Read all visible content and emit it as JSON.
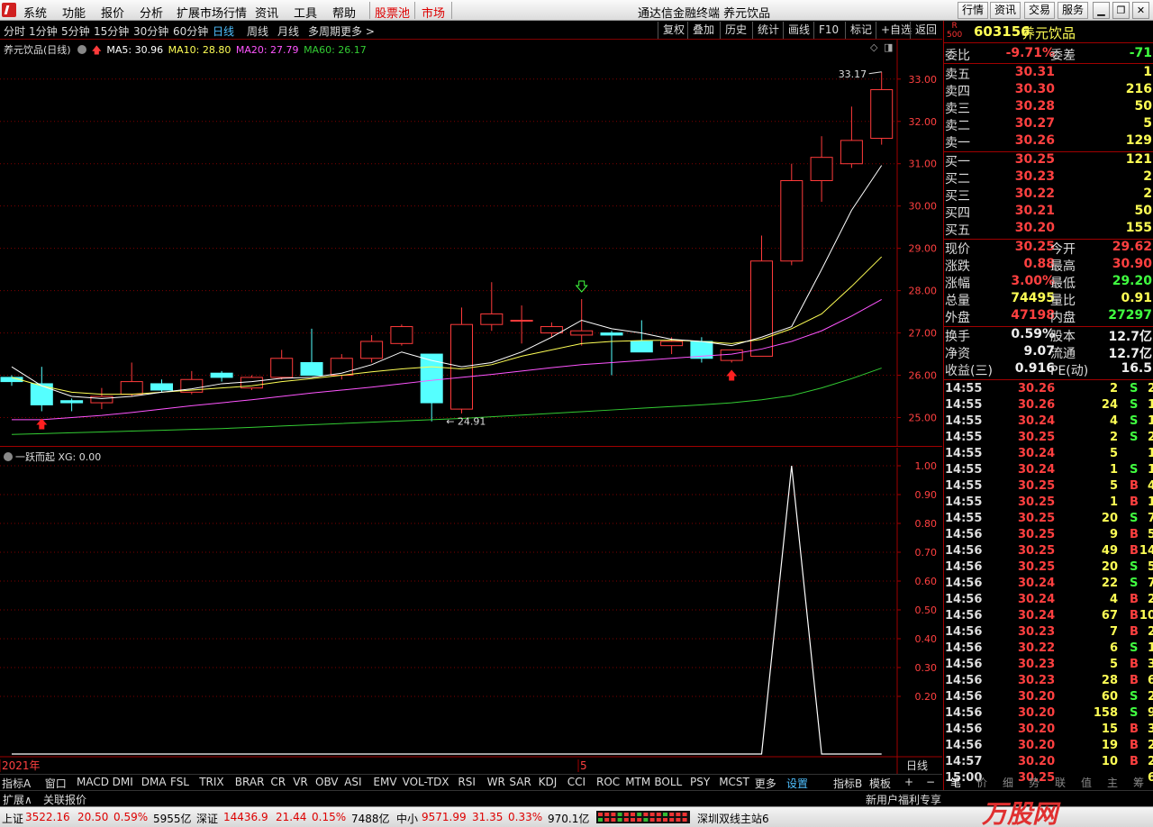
{
  "menubar": {
    "items": [
      "系统",
      "功能",
      "报价",
      "分析",
      "扩展市场行情",
      "资讯",
      "工具",
      "帮助"
    ],
    "stock_pool": "股票池",
    "market": "市场",
    "title": "通达信金融终端  养元饮品",
    "right_buttons": [
      "行情",
      "资讯",
      "交易",
      "服务"
    ]
  },
  "periodbar": {
    "periods": [
      "分时",
      "1分钟",
      "5分钟",
      "15分钟",
      "30分钟",
      "60分钟",
      "日线",
      "周线",
      "月线",
      "多周期",
      "更多 >"
    ],
    "active": "日线",
    "tools": [
      "复权",
      "叠加",
      "历史",
      "统计",
      "画线",
      "F10",
      "标记",
      "+自选",
      "返回"
    ]
  },
  "legend": {
    "stock": "养元饮品(日线)",
    "ma5": "MA5: 30.96",
    "ma10": "MA10: 28.80",
    "ma20": "MA20: 27.79",
    "ma60": "MA60: 26.17",
    "high_label": "33.17",
    "low_label": "24.91"
  },
  "colors": {
    "ma5": "#ffffff",
    "ma10": "#ffff55",
    "ma20": "#ff55ff",
    "ma60": "#33cc33",
    "up": "#ff3b3b",
    "down": "#55ffff",
    "grid": "#800000"
  },
  "chart_data": [
    {
      "type": "candlestick",
      "ylim": [
        24.5,
        33.4
      ],
      "y_ticks": [
        25.0,
        26.0,
        27.0,
        28.0,
        29.0,
        30.0,
        31.0,
        32.0,
        33.0
      ],
      "x_labels": [
        "2021年",
        "5"
      ],
      "ohlc": [
        [
          25.95,
          26.0,
          25.75,
          25.85
        ],
        [
          25.8,
          26.2,
          25.15,
          25.3
        ],
        [
          25.4,
          25.45,
          25.15,
          25.35
        ],
        [
          25.35,
          25.7,
          25.2,
          25.5
        ],
        [
          25.55,
          26.3,
          25.5,
          25.85
        ],
        [
          25.8,
          25.9,
          25.6,
          25.65
        ],
        [
          25.6,
          26.1,
          25.55,
          25.9
        ],
        [
          26.05,
          26.1,
          25.85,
          25.95
        ],
        [
          25.7,
          26.0,
          25.65,
          25.95
        ],
        [
          25.95,
          26.6,
          25.9,
          26.4
        ],
        [
          26.3,
          27.1,
          26.0,
          26.0
        ],
        [
          26.0,
          26.5,
          25.9,
          26.4
        ],
        [
          26.4,
          26.95,
          26.3,
          26.8
        ],
        [
          26.75,
          27.2,
          26.7,
          27.15
        ],
        [
          26.5,
          26.5,
          24.91,
          25.35
        ],
        [
          25.2,
          27.6,
          25.1,
          27.2
        ],
        [
          27.2,
          28.2,
          27.05,
          27.45
        ],
        [
          27.3,
          27.65,
          26.75,
          27.3
        ],
        [
          27.0,
          27.25,
          26.9,
          27.15
        ],
        [
          26.95,
          27.8,
          26.7,
          27.05
        ],
        [
          27.0,
          27.05,
          26.0,
          26.95
        ],
        [
          26.8,
          27.3,
          26.55,
          26.55
        ],
        [
          26.7,
          26.9,
          26.5,
          26.8
        ],
        [
          26.8,
          26.9,
          26.3,
          26.4
        ],
        [
          26.35,
          26.6,
          26.3,
          26.6
        ],
        [
          26.45,
          29.3,
          26.45,
          28.7
        ],
        [
          28.7,
          31.0,
          28.6,
          30.6
        ],
        [
          30.6,
          31.65,
          30.1,
          31.15
        ],
        [
          31.0,
          32.35,
          30.9,
          31.55
        ],
        [
          31.6,
          33.17,
          31.45,
          32.75
        ]
      ],
      "ma5": [
        26.2,
        25.75,
        25.5,
        25.45,
        25.5,
        25.6,
        25.68,
        25.8,
        25.85,
        25.93,
        25.95,
        26.05,
        26.25,
        26.55,
        26.35,
        26.2,
        26.3,
        26.55,
        26.9,
        27.3,
        27.1,
        27.0,
        26.85,
        26.8,
        26.7,
        26.9,
        27.15,
        28.5,
        29.9,
        30.96
      ],
      "ma10": [
        25.95,
        25.75,
        25.6,
        25.55,
        25.55,
        25.6,
        25.65,
        25.7,
        25.75,
        25.85,
        25.92,
        26.0,
        26.08,
        26.15,
        26.2,
        26.15,
        26.25,
        26.45,
        26.6,
        26.75,
        26.8,
        26.82,
        26.83,
        26.8,
        26.75,
        26.85,
        27.1,
        27.45,
        28.1,
        28.8
      ],
      "ma20": [
        24.95,
        24.95,
        25.0,
        25.05,
        25.12,
        25.2,
        25.28,
        25.35,
        25.42,
        25.5,
        25.58,
        25.65,
        25.72,
        25.8,
        25.88,
        25.95,
        26.02,
        26.1,
        26.18,
        26.25,
        26.3,
        26.35,
        26.4,
        26.45,
        26.5,
        26.62,
        26.8,
        27.05,
        27.4,
        27.79
      ],
      "ma60": [
        24.6,
        24.62,
        24.64,
        24.66,
        24.68,
        24.7,
        24.72,
        24.74,
        24.77,
        24.8,
        24.83,
        24.86,
        24.89,
        24.92,
        24.95,
        24.98,
        25.02,
        25.06,
        25.1,
        25.14,
        25.18,
        25.22,
        25.26,
        25.3,
        25.35,
        25.42,
        25.52,
        25.7,
        25.92,
        26.17
      ],
      "signal_arrows_up": [
        1,
        24
      ],
      "signal_arrows_down": [
        19
      ]
    },
    {
      "type": "line",
      "name": "一跃而起",
      "title": "一跃而起  XG: 0.00",
      "ylim": [
        0,
        1.0
      ],
      "y_ticks": [
        0.2,
        0.3,
        0.4,
        0.5,
        0.6,
        0.7,
        0.8,
        0.9,
        1.0
      ],
      "values": [
        0,
        0,
        0,
        0,
        0,
        0,
        0,
        0,
        0,
        0,
        0,
        0,
        0,
        0,
        0,
        0,
        0,
        0,
        0,
        0,
        0,
        0,
        0,
        0,
        0,
        0,
        1,
        0,
        0,
        0
      ]
    }
  ],
  "period_label": "日线",
  "indicator_tabs": [
    "指标A",
    "窗口",
    "MACD",
    "DMI",
    "DMA",
    "FSL",
    "TRIX",
    "BRAR",
    "CR",
    "VR",
    "OBV",
    "ASI",
    "EMV",
    "VOL-TDX",
    "RSI",
    "WR",
    "SAR",
    "KDJ",
    "CCI",
    "ROC",
    "MTM",
    "BOLL",
    "PSY",
    "MCST",
    "更多",
    "设置"
  ],
  "indicator_right_tabs": [
    "指标B",
    "模板",
    "+",
    "−"
  ],
  "ext_bar": [
    "扩展∧",
    "关联报价",
    "新用户福利专享"
  ],
  "quote": {
    "badge_top": "R",
    "badge_bottom": "500",
    "code": "603156",
    "name": "养元饮品",
    "weibi_label": "委比",
    "weibi": "-9.71%",
    "weicha_label": "委差",
    "weicha": "-71",
    "sell": [
      {
        "label": "卖五",
        "price": "30.31",
        "vol": "1"
      },
      {
        "label": "卖四",
        "price": "30.30",
        "vol": "216"
      },
      {
        "label": "卖三",
        "price": "30.28",
        "vol": "50"
      },
      {
        "label": "卖二",
        "price": "30.27",
        "vol": "5"
      },
      {
        "label": "卖一",
        "price": "30.26",
        "vol": "129"
      }
    ],
    "buy": [
      {
        "label": "买一",
        "price": "30.25",
        "vol": "121"
      },
      {
        "label": "买二",
        "price": "30.23",
        "vol": "2"
      },
      {
        "label": "买三",
        "price": "30.22",
        "vol": "2"
      },
      {
        "label": "买四",
        "price": "30.21",
        "vol": "50"
      },
      {
        "label": "买五",
        "price": "30.20",
        "vol": "155"
      }
    ],
    "stats": [
      {
        "l": "现价",
        "v": "30.25",
        "vc": "red",
        "l2": "今开",
        "v2": "29.62",
        "v2c": "red"
      },
      {
        "l": "涨跌",
        "v": "0.88",
        "vc": "red",
        "l2": "最高",
        "v2": "30.90",
        "v2c": "red"
      },
      {
        "l": "涨幅",
        "v": "3.00%",
        "vc": "red",
        "l2": "最低",
        "v2": "29.20",
        "v2c": "green"
      },
      {
        "l": "总量",
        "v": "74495",
        "vc": "yellow",
        "l2": "量比",
        "v2": "0.91",
        "v2c": "yellow"
      },
      {
        "l": "外盘",
        "v": "47198",
        "vc": "red",
        "l2": "内盘",
        "v2": "27297",
        "v2c": "green"
      }
    ],
    "stats2": [
      {
        "l": "换手",
        "v": "0.59%",
        "l2": "股本",
        "v2": "12.7亿"
      },
      {
        "l": "净资",
        "v": "9.07",
        "l2": "流通",
        "v2": "12.7亿"
      },
      {
        "l": "收益(三)",
        "v": "0.916",
        "l2": "PE(动)",
        "v2": "16.5"
      }
    ],
    "ticks": [
      [
        "14:55",
        "30.26",
        "2",
        "S",
        "2"
      ],
      [
        "14:55",
        "30.26",
        "24",
        "S",
        "1"
      ],
      [
        "14:55",
        "30.24",
        "4",
        "S",
        "1"
      ],
      [
        "14:55",
        "30.25",
        "2",
        "S",
        "2"
      ],
      [
        "14:55",
        "30.24",
        "5",
        "",
        "1"
      ],
      [
        "14:55",
        "30.24",
        "1",
        "S",
        "1"
      ],
      [
        "14:55",
        "30.25",
        "5",
        "B",
        "4"
      ],
      [
        "14:55",
        "30.25",
        "1",
        "B",
        "1"
      ],
      [
        "14:55",
        "30.25",
        "20",
        "S",
        "7"
      ],
      [
        "14:56",
        "30.25",
        "9",
        "B",
        "5"
      ],
      [
        "14:56",
        "30.25",
        "49",
        "B",
        "14"
      ],
      [
        "14:56",
        "30.25",
        "20",
        "S",
        "5"
      ],
      [
        "14:56",
        "30.24",
        "22",
        "S",
        "7"
      ],
      [
        "14:56",
        "30.24",
        "4",
        "B",
        "2"
      ],
      [
        "14:56",
        "30.24",
        "67",
        "B",
        "10"
      ],
      [
        "14:56",
        "30.23",
        "7",
        "B",
        "2"
      ],
      [
        "14:56",
        "30.22",
        "6",
        "S",
        "1"
      ],
      [
        "14:56",
        "30.23",
        "5",
        "B",
        "3"
      ],
      [
        "14:56",
        "30.23",
        "28",
        "B",
        "6"
      ],
      [
        "14:56",
        "30.20",
        "60",
        "S",
        "2"
      ],
      [
        "14:56",
        "30.20",
        "158",
        "S",
        "9"
      ],
      [
        "14:56",
        "30.20",
        "15",
        "B",
        "3"
      ],
      [
        "14:56",
        "30.20",
        "19",
        "B",
        "2"
      ],
      [
        "14:57",
        "30.20",
        "10",
        "B",
        "2"
      ],
      [
        "15:00",
        "30.25",
        "",
        "",
        "6"
      ]
    ],
    "bottom_tabs": [
      "笔",
      "价",
      "细",
      "势",
      "联",
      "值",
      "主",
      "筹"
    ]
  },
  "statusbar": {
    "sh_label": "上证",
    "sh_val": "3522.16",
    "sh_chg": "20.50",
    "sh_pct": "0.59%",
    "sh_amt": "5955亿",
    "sz_label": "深证",
    "sz_val": "14436.9",
    "sz_chg": "21.44",
    "sz_pct": "0.15%",
    "sz_amt": "7488亿",
    "zx_label": "中小",
    "zx_val": "9571.99",
    "zx_chg": "31.35",
    "zx_pct": "0.33%",
    "zx_amt": "970.1亿",
    "server": "深圳双线主站6"
  },
  "watermark": "万股网"
}
